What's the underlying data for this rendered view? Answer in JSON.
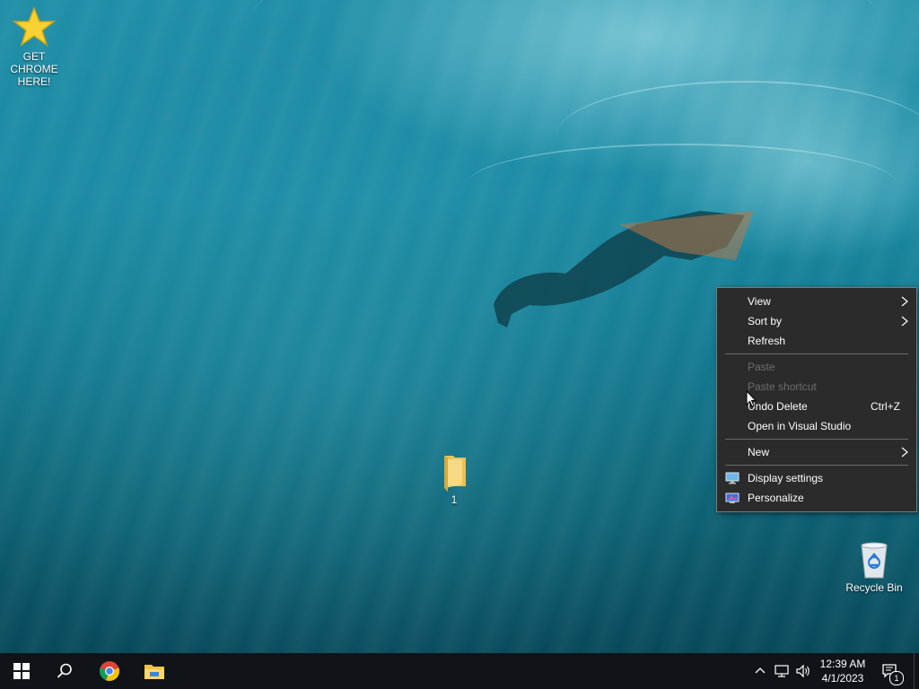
{
  "desktop": {
    "icons": [
      {
        "label": "GET CHROME HERE!",
        "icon": "star-icon"
      },
      {
        "label": "1",
        "icon": "folder-icon"
      },
      {
        "label": "Recycle Bin",
        "icon": "recycle-bin-icon"
      }
    ]
  },
  "context_menu": {
    "items": {
      "view": {
        "label": "View",
        "submenu": true
      },
      "sort_by": {
        "label": "Sort by",
        "submenu": true
      },
      "refresh": {
        "label": "Refresh"
      },
      "paste": {
        "label": "Paste",
        "disabled": true
      },
      "paste_shortcut": {
        "label": "Paste shortcut",
        "disabled": true
      },
      "undo_delete": {
        "label": "Undo Delete",
        "shortcut": "Ctrl+Z"
      },
      "open_vs": {
        "label": "Open in Visual Studio"
      },
      "new": {
        "label": "New",
        "submenu": true
      },
      "display_settings": {
        "label": "Display settings",
        "icon": "display-settings-icon"
      },
      "personalize": {
        "label": "Personalize",
        "icon": "personalize-icon"
      }
    }
  },
  "taskbar": {
    "buttons": [
      "windows-start-icon",
      "search-icon",
      "chrome-icon",
      "file-explorer-icon"
    ],
    "tray_icons": [
      "chevron-up-icon",
      "network-icon",
      "volume-icon"
    ],
    "time": "12:39 AM",
    "date": "4/1/2023",
    "notification_count": "1"
  },
  "colors": {
    "menu_bg": "#2b2b2b",
    "menu_text": "#ffffff",
    "menu_disabled": "#6d6d6d",
    "taskbar_bg": "#101418"
  }
}
